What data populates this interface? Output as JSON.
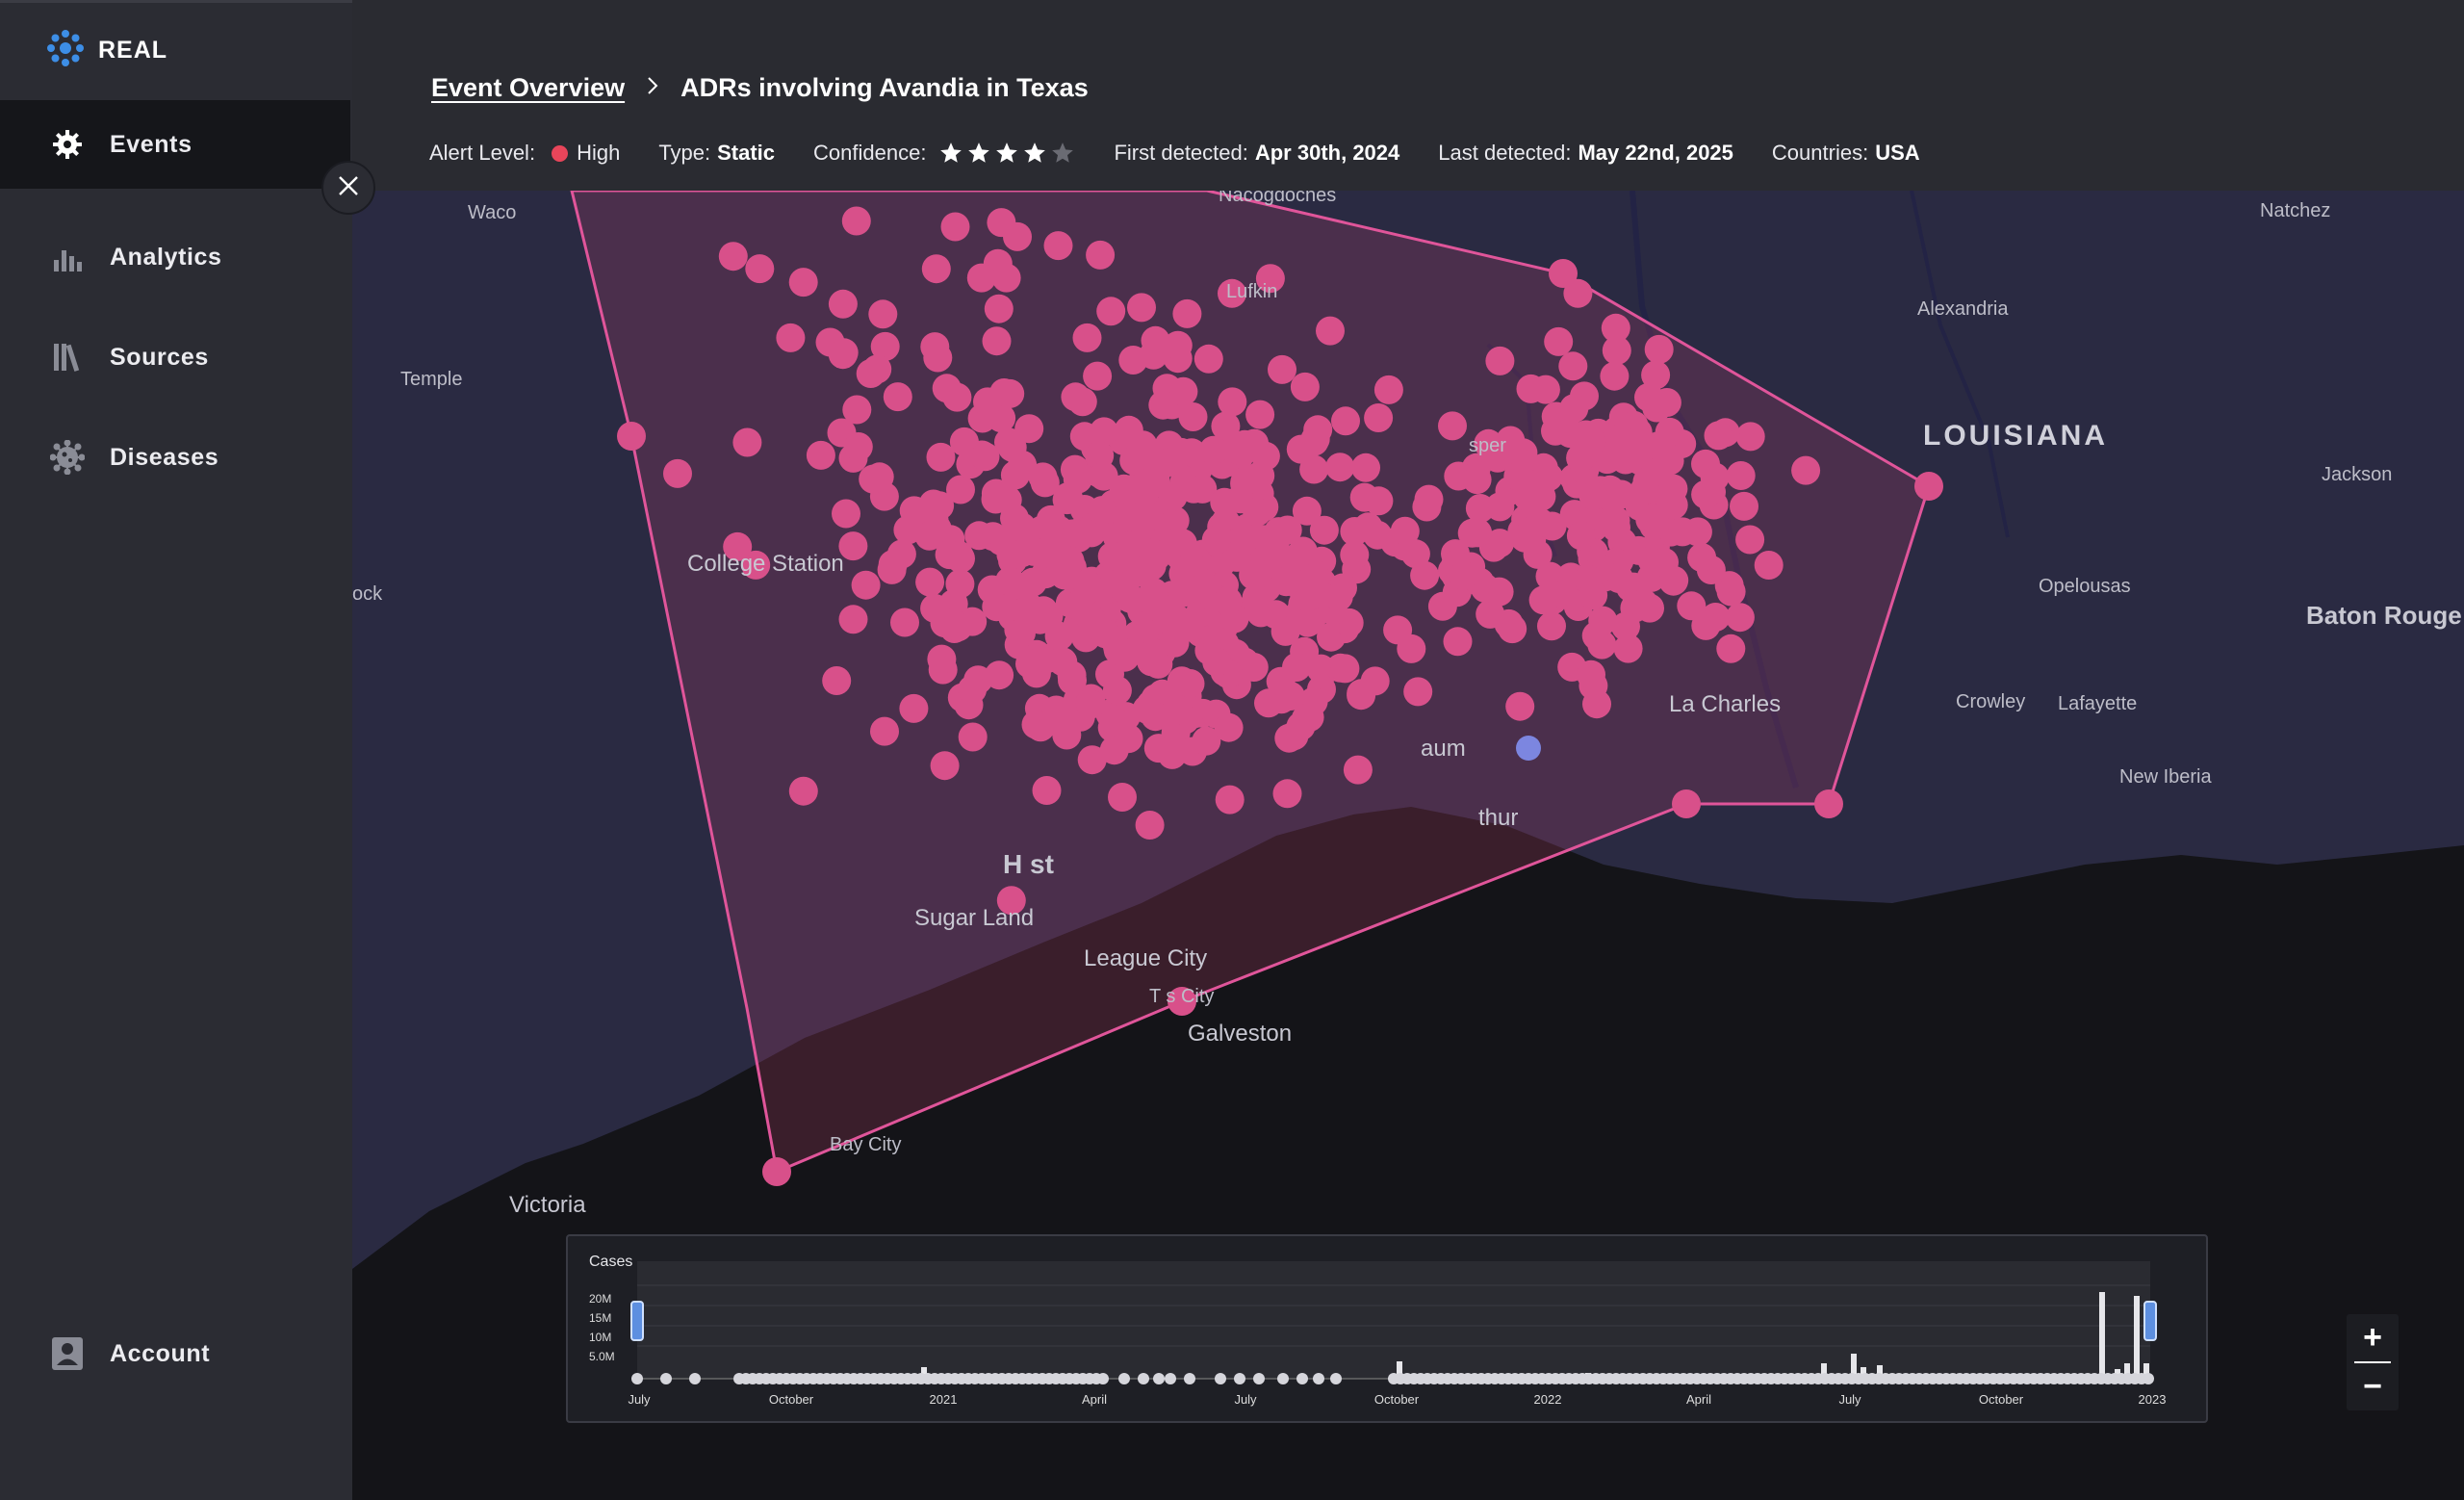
{
  "app": {
    "name": "REAL"
  },
  "sidebar": {
    "items": [
      {
        "label": "Events",
        "icon": "events-gear-icon",
        "active": true
      },
      {
        "label": "Analytics",
        "icon": "bar-chart-icon",
        "active": false
      },
      {
        "label": "Sources",
        "icon": "books-icon",
        "active": false
      },
      {
        "label": "Diseases",
        "icon": "virus-icon",
        "active": false
      }
    ],
    "account_label": "Account"
  },
  "header": {
    "breadcrumb_link": "Event Overview",
    "title": "ADRs involving Avandia in Texas",
    "alert_level_label": "Alert Level:",
    "alert_level_value": "High",
    "type_label": "Type:",
    "type_value": "Static",
    "confidence_label": "Confidence:",
    "confidence_stars": 4,
    "confidence_max": 5,
    "first_detected_label": "First detected:",
    "first_detected_value": "Apr 30th, 2024",
    "last_detected_label": "Last detected:",
    "last_detected_value": "May 22nd, 2025",
    "countries_label": "Countries:",
    "countries_value": "USA"
  },
  "map": {
    "places": {
      "waco": "Waco",
      "temple": "Temple",
      "rock": "ock",
      "college_station": "College Station",
      "nacogdoches": "Nacogdoches",
      "lufkin": "Lufkin",
      "jasper": "sper",
      "natchez": "Natchez",
      "alexandria": "Alexandria",
      "louisiana": "LOUISIANA",
      "jackson": "Jackson",
      "opelousas": "Opelousas",
      "baton_rouge": "Baton Rouge",
      "crowley": "Crowley",
      "lafayette": "Lafayette",
      "lake_charles": "La  Charles",
      "new_iberia": "New Iberia",
      "beaumont": "aum",
      "port_arthur": "thur",
      "houston": "H  st",
      "sugar_land": "Sugar Land",
      "league_city": "League City",
      "texas_city": "T  s City",
      "galveston": "Galveston",
      "bay_city": "Bay City",
      "victoria": "Victoria"
    },
    "colors": {
      "cluster": "#d8508a",
      "highlight": "#7c86e0",
      "polygon_stroke": "#e0559a"
    },
    "zoom_in": "+",
    "zoom_out": "−"
  },
  "timeline": {
    "y_label": "Cases",
    "y_ticks": [
      "20M",
      "15M",
      "10M",
      "5.0M"
    ],
    "x_ticks": [
      "July",
      "October",
      "2021",
      "April",
      "July",
      "October",
      "2022",
      "April",
      "July",
      "October",
      "2023"
    ]
  }
}
